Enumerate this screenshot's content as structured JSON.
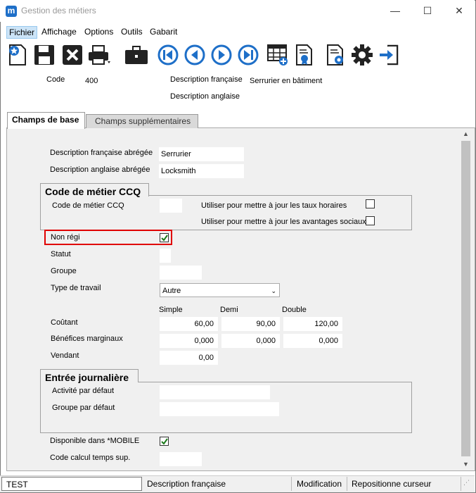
{
  "window": {
    "title": "Gestion des métiers",
    "minimize": "—",
    "maximize": "☐",
    "close": "✕"
  },
  "menu": [
    "Fichier",
    "Affichage",
    "Options",
    "Outils",
    "Gabarit"
  ],
  "header": {
    "code_label": "Code",
    "code_value": "400",
    "desc_fr_label": "Description française",
    "desc_fr_value": "Serrurier en bâtiment",
    "desc_en_label": "Description anglaise"
  },
  "tabs": {
    "base": "Champs de base",
    "supp": "Champs supplémentaires"
  },
  "form": {
    "desc_fr_abbr_label": "Description française abrégée",
    "desc_fr_abbr_value": "Serrurier",
    "desc_en_abbr_label": "Description anglaise abrégée",
    "desc_en_abbr_value": "Locksmith",
    "ccq_group_title": "Code de métier CCQ",
    "ccq_code_label": "Code de métier CCQ",
    "ccq_rates_label": "Utiliser pour mettre à jour les taux horaires",
    "ccq_benefits_label": "Utiliser pour mettre à jour les avantages sociaux",
    "non_regi_label": "Non régi",
    "statut_label": "Statut",
    "groupe_label": "Groupe",
    "type_travail_label": "Type de travail",
    "type_travail_value": "Autre",
    "col_simple": "Simple",
    "col_demi": "Demi",
    "col_double": "Double",
    "coutant_label": "Coûtant",
    "coutant": [
      "60,00",
      "90,00",
      "120,00"
    ],
    "benefices_label": "Bénéfices marginaux",
    "benefices": [
      "0,000",
      "0,000",
      "0,000"
    ],
    "vendant_label": "Vendant",
    "vendant_value": "0,00",
    "journal_group_title": "Entrée journalière",
    "activite_label": "Activité par défaut",
    "groupe_defaut_label": "Groupe par défaut",
    "mobile_label": "Disponible dans *MOBILE",
    "code_calcul_label": "Code calcul temps sup."
  },
  "status": {
    "field": "TEST",
    "desc": "Description française",
    "mode": "Modification",
    "action": "Repositionne curseur"
  },
  "colors": {
    "highlight_box": "#e00000",
    "check": "#1a7a1a",
    "toolbar_blue": "#1e6fc8"
  }
}
